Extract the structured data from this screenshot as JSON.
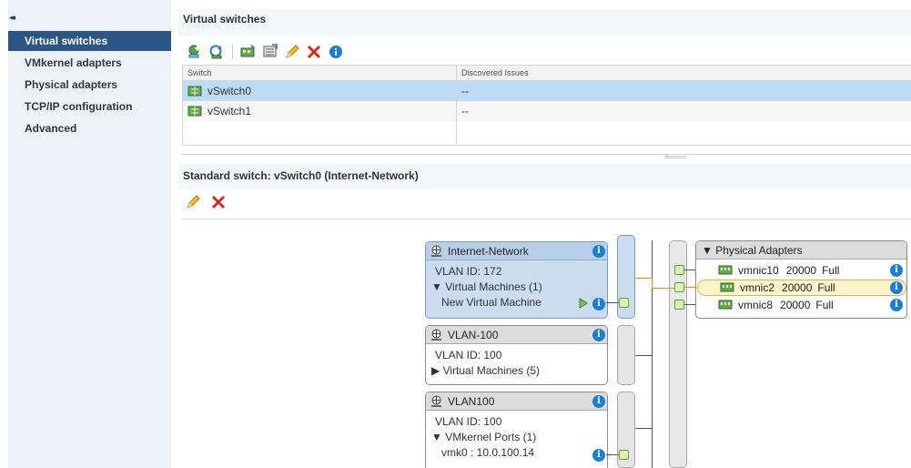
{
  "sidebar": {
    "collapse_glyph": "◂◂",
    "items": [
      {
        "label": "Virtual switches",
        "active": true
      },
      {
        "label": "VMkernel adapters",
        "active": false
      },
      {
        "label": "Physical adapters",
        "active": false
      },
      {
        "label": "TCP/IP configuration",
        "active": false
      },
      {
        "label": "Advanced",
        "active": false
      }
    ]
  },
  "virtual_switches": {
    "title": "Virtual switches",
    "toolbar_icons": [
      "add-networking-icon",
      "refresh-icon",
      "manage-adapters-icon",
      "migrate-icon",
      "edit-icon",
      "delete-icon",
      "info-icon"
    ],
    "columns": [
      "Switch",
      "Discovered Issues"
    ],
    "rows": [
      {
        "switch": "vSwitch0",
        "issues": "--",
        "selected": true
      },
      {
        "switch": "vSwitch1",
        "issues": "--",
        "selected": false
      }
    ]
  },
  "standard_switch": {
    "title": "Standard switch: vSwitch0 (Internet-Network)",
    "toolbar_icons": [
      "edit-icon",
      "delete-icon"
    ]
  },
  "diagram": {
    "port_groups": [
      {
        "name": "Internet-Network",
        "vlan": "VLAN ID: 172",
        "section": "▼ Virtual Machines (1)",
        "member": "New Virtual Machine",
        "selected": true
      },
      {
        "name": "VLAN-100",
        "vlan": "VLAN ID: 100",
        "section": "▶ Virtual Machines (5)",
        "selected": false
      },
      {
        "name": "VLAN100",
        "vlan": "VLAN ID: 100",
        "section": "▼ VMkernel Ports (1)",
        "member": "vmk0 : 10.0.100.14",
        "selected": false
      }
    ],
    "physical_adapters": {
      "header": "▼  Physical Adapters",
      "nics": [
        {
          "name": "vmnic10",
          "speed": "20000",
          "duplex": "Full",
          "selected": false
        },
        {
          "name": "vmnic2",
          "speed": "20000",
          "duplex": "Full",
          "selected": true
        },
        {
          "name": "vmnic8",
          "speed": "20000",
          "duplex": "Full",
          "selected": false
        }
      ]
    },
    "info_glyph": "i",
    "colors": {
      "selection_blue": "#bcdcf5",
      "active_nav": "#2c5685",
      "link_orange": "#f08a10",
      "info_blue": "#1a7fd4"
    }
  }
}
